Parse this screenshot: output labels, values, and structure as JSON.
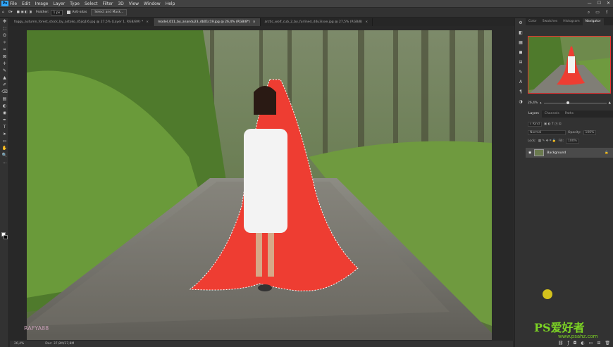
{
  "app": {
    "logo": "Ps"
  },
  "menu": [
    "File",
    "Edit",
    "Image",
    "Layer",
    "Type",
    "Select",
    "Filter",
    "3D",
    "View",
    "Window",
    "Help"
  ],
  "window_controls": [
    "—",
    "☐",
    "✕"
  ],
  "options": {
    "feather_label": "Feather:",
    "feather_value": "1 px",
    "antialias_label": "Anti-alias",
    "select_mask_label": "Select and Mask..."
  },
  "tabs": [
    {
      "label": "foggy_autumn_forest_stock_by_astoko_d5jiq1l6.jpg @ 27,5% (Layer 1, RGB/8#) *",
      "active": false
    },
    {
      "label": "model_011_by_anandu23_db01c19.jpg @ 26,4% (RGB/8*)",
      "active": true
    },
    {
      "label": "arctic_wolf_cub_2_by_furlined_d4u3ixxe.jpg @ 27,5% (RGB/8)",
      "active": false
    }
  ],
  "tab_close": "×",
  "tools": [
    "✥",
    "⬚",
    "ʘ",
    "✧",
    "⌗",
    "⊠",
    "✛",
    "✎",
    "▲",
    "✐",
    "⌫",
    "▤",
    "◐",
    "◉",
    "✒",
    "T",
    "➤",
    "▭",
    "✋",
    "🔍",
    "…"
  ],
  "status": {
    "zoom": "26,4%",
    "doc": "Doc: 37,8M/37,8M"
  },
  "right_panel": {
    "top_tabs": [
      {
        "label": "Color",
        "active": false
      },
      {
        "label": "Swatches",
        "active": false
      },
      {
        "label": "Histogram",
        "active": false
      },
      {
        "label": "Navigator",
        "active": true
      }
    ],
    "navigator_zoom": "26,4%",
    "layer_tabs": [
      {
        "label": "Layers",
        "active": true
      },
      {
        "label": "Channels",
        "active": false
      },
      {
        "label": "Paths",
        "active": false
      }
    ],
    "kind_label": "Kind",
    "blend_mode": "Normal",
    "opacity_label": "Opacity:",
    "opacity_value": "100%",
    "lock_label": "Lock:",
    "fill_label": "Fill:",
    "fill_value": "100%",
    "layer_name": "Background"
  },
  "icon_strip": [
    "⚙",
    "◧",
    "▦",
    "◼",
    "⊞",
    "✎",
    "A",
    "¶",
    "◑"
  ],
  "watermark": {
    "title": "PS爱好者",
    "site": "www.psahz.com"
  },
  "creator_tag": "RAFYA88"
}
